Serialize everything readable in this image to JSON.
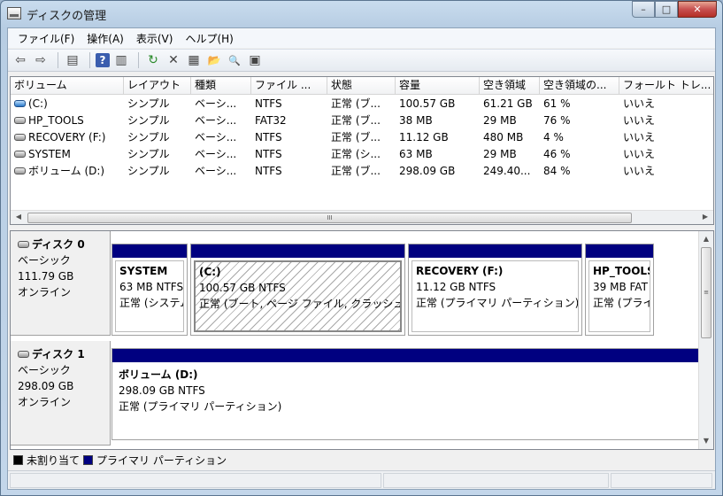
{
  "window": {
    "title": "ディスクの管理",
    "min": "–",
    "max": "□",
    "close": "✕"
  },
  "menu": [
    "ファイル(F)",
    "操作(A)",
    "表示(V)",
    "ヘルプ(H)"
  ],
  "toolbar": {
    "back": "⇦",
    "forward": "⇨",
    "console": "▤",
    "help": "?",
    "properties_view": "▥",
    "refresh": "↻",
    "delete": "✕",
    "properties": "▦",
    "open": "📂",
    "search": "🔍",
    "settings": "▣"
  },
  "volumes": {
    "columns": [
      "ボリューム",
      "レイアウト",
      "種類",
      "ファイル ...",
      "状態",
      "容量",
      "空き領域",
      "空き領域の...",
      "フォールト トレ..."
    ],
    "rows": [
      {
        "icon": "blue",
        "name": "(C:)",
        "layout": "シンプル",
        "type": "ベーシ...",
        "fs": "NTFS",
        "status": "正常 (ブ...",
        "capacity": "100.57 GB",
        "free": "61.21 GB",
        "free_pct": "61 %",
        "fault": "いいえ"
      },
      {
        "icon": "gray",
        "name": "HP_TOOLS",
        "layout": "シンプル",
        "type": "ベーシ...",
        "fs": "FAT32",
        "status": "正常 (ブ...",
        "capacity": "38 MB",
        "free": "29 MB",
        "free_pct": "76 %",
        "fault": "いいえ"
      },
      {
        "icon": "gray",
        "name": "RECOVERY (F:)",
        "layout": "シンプル",
        "type": "ベーシ...",
        "fs": "NTFS",
        "status": "正常 (ブ...",
        "capacity": "11.12 GB",
        "free": "480 MB",
        "free_pct": "4 %",
        "fault": "いいえ"
      },
      {
        "icon": "gray",
        "name": "SYSTEM",
        "layout": "シンプル",
        "type": "ベーシ...",
        "fs": "NTFS",
        "status": "正常 (シ...",
        "capacity": "63 MB",
        "free": "29 MB",
        "free_pct": "46 %",
        "fault": "いいえ"
      },
      {
        "icon": "gray",
        "name": "ボリューム (D:)",
        "layout": "シンプル",
        "type": "ベーシ...",
        "fs": "NTFS",
        "status": "正常 (ブ...",
        "capacity": "298.09 GB",
        "free": "249.40...",
        "free_pct": "84 %",
        "fault": "いいえ"
      }
    ],
    "hscroll_grip": "III"
  },
  "disks": [
    {
      "name": "ディスク 0",
      "kind": "ベーシック",
      "size": "111.79 GB",
      "state": "オンライン",
      "partitions": [
        {
          "name": "SYSTEM",
          "size": "63 MB NTFS",
          "status": "正常 (システム",
          "selected": false
        },
        {
          "name": "(C:)",
          "size": "100.57 GB NTFS",
          "status": "正常 (ブート, ページ ファイル, クラッシュ",
          "selected": true
        },
        {
          "name": "RECOVERY  (F:)",
          "size": "11.12 GB NTFS",
          "status": "正常 (プライマリ パーティション)",
          "selected": false
        },
        {
          "name": "HP_TOOLS",
          "size": "39 MB FAT",
          "status": "正常 (プライ",
          "selected": false
        }
      ]
    },
    {
      "name": "ディスク 1",
      "kind": "ベーシック",
      "size": "298.09 GB",
      "state": "オンライン",
      "partitions": [
        {
          "name": "ボリューム  (D:)",
          "size": "298.09 GB NTFS",
          "status": "正常 (プライマリ パーティション)",
          "selected": false
        }
      ]
    }
  ],
  "legend": [
    {
      "label": "未割り当て",
      "color": "#000000"
    },
    {
      "label": "プライマリ パーティション",
      "color": "#000080"
    }
  ],
  "colors": {
    "partition_bar": "#000080",
    "window_frame": "#b7cde3"
  }
}
